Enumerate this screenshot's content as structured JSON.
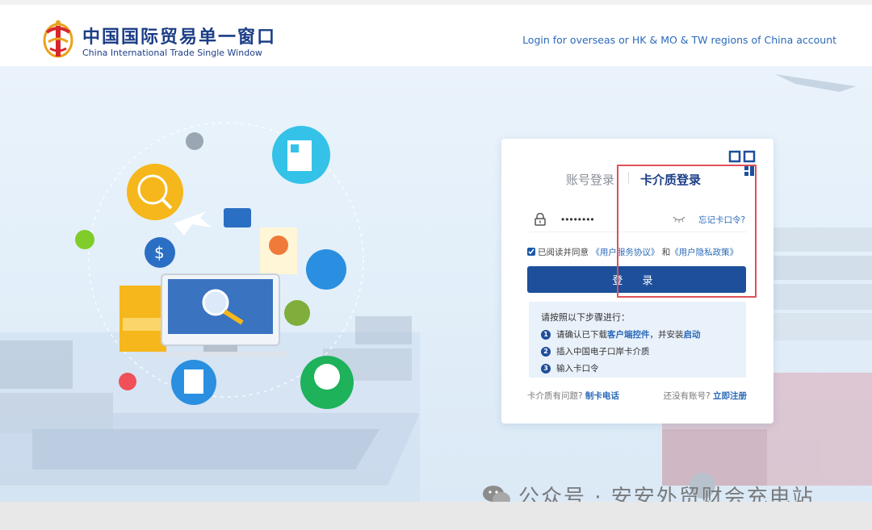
{
  "header": {
    "logo_cn": "中国国际贸易单一窗口",
    "logo_en": "China International Trade Single Window",
    "overseas_link": "Login for overseas or HK & MO & TW regions of China account"
  },
  "login": {
    "tabs": [
      {
        "label": "账号登录",
        "active": false
      },
      {
        "label": "卡介质登录",
        "active": true
      }
    ],
    "password_value": "••••••••",
    "forgot_label": "忘记卡口令?",
    "agree_prefix": "已阅读并同意",
    "service_agreement": "《用户服务协议》",
    "agree_and": "和",
    "privacy_policy": "《用户隐私政策》",
    "login_button": "登 录",
    "steps": {
      "title": "请按照以下步骤进行：",
      "step1_prefix": "请确认已下载",
      "step1_link1": "客户端控件",
      "step1_middle": "，并安装",
      "step1_link2": "启动",
      "step2": "插入中国电子口岸卡介质",
      "step3": "输入卡口令"
    },
    "footer": {
      "card_issue_text": "卡介质有问题?",
      "card_phone_link": "制卡电话",
      "no_account_text": "还没有账号?",
      "register_link": "立即注册"
    }
  },
  "watermark": "公众号 · 安安外贸财会充电站",
  "colors": {
    "primary": "#1d4f9b",
    "link": "#2a6ab8",
    "brand": "#1c3e86",
    "highlight": "#e0505a"
  }
}
